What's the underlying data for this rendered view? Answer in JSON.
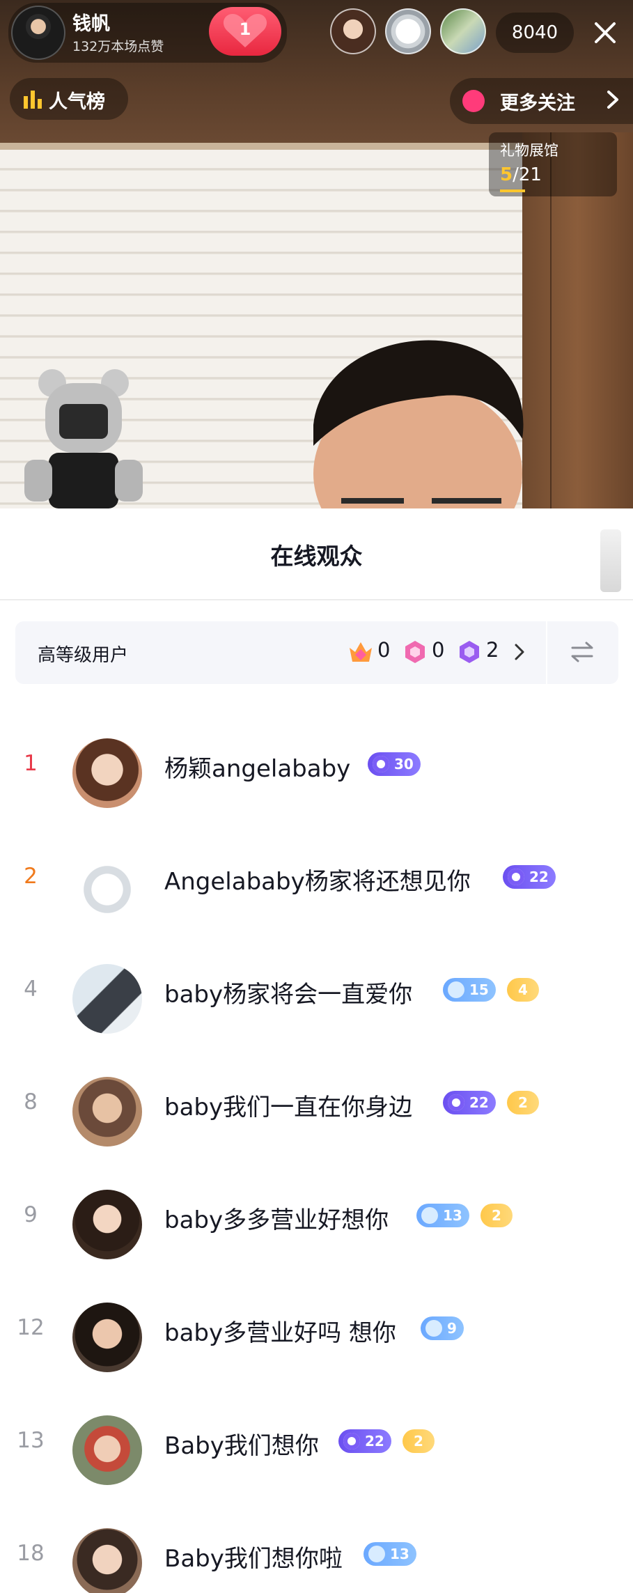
{
  "host": {
    "name": "钱帆",
    "likes": "132万本场点赞",
    "like_count": "1"
  },
  "viewers": {
    "count": "8040"
  },
  "top_bar": {
    "rank_label": "人气榜",
    "more_follow_label": "更多关注"
  },
  "gift_hall": {
    "label": "礼物展馆",
    "current": "5",
    "total": "/21"
  },
  "sheet": {
    "title": "在线观众",
    "high_level_label": "高等级用户",
    "tiers": [
      {
        "icon": "crown-gem-icon",
        "count": "0"
      },
      {
        "icon": "pink-gem-icon",
        "count": "0"
      },
      {
        "icon": "purple-gem-icon",
        "count": "2"
      }
    ]
  },
  "audience": [
    {
      "rank": "1",
      "name": "杨颖angelababy",
      "badges": [
        {
          "type": "purple",
          "text": "30"
        }
      ]
    },
    {
      "rank": "2",
      "name": "Angelababy杨家将还想见你",
      "badges": [
        {
          "type": "purple",
          "text": "22"
        }
      ]
    },
    {
      "rank": "4",
      "name": "baby杨家将会一直爱你",
      "badges": [
        {
          "type": "blue",
          "text": "15"
        },
        {
          "type": "gold",
          "text": "4"
        }
      ]
    },
    {
      "rank": "8",
      "name": "baby我们一直在你身边",
      "badges": [
        {
          "type": "purple",
          "text": "22"
        },
        {
          "type": "gold",
          "text": "2"
        }
      ]
    },
    {
      "rank": "9",
      "name": "baby多多营业好想你",
      "badges": [
        {
          "type": "blue",
          "text": "13"
        },
        {
          "type": "gold",
          "text": "2"
        }
      ]
    },
    {
      "rank": "12",
      "name": "baby多营业好吗 想你",
      "badges": [
        {
          "type": "blue",
          "text": "9"
        }
      ]
    },
    {
      "rank": "13",
      "name": "Baby我们想你",
      "badges": [
        {
          "type": "purple",
          "text": "22"
        },
        {
          "type": "gold",
          "text": "2"
        }
      ]
    },
    {
      "rank": "18",
      "name": "Baby我们想你啦",
      "badges": [
        {
          "type": "blue",
          "text": "13"
        }
      ]
    }
  ],
  "colors": {
    "rank_first": "#e83a4a",
    "rank_second": "#f07a1c",
    "rank_other": "#9a9ca3",
    "live_red": "#e8273f",
    "gift_gold": "#ffc62e"
  }
}
